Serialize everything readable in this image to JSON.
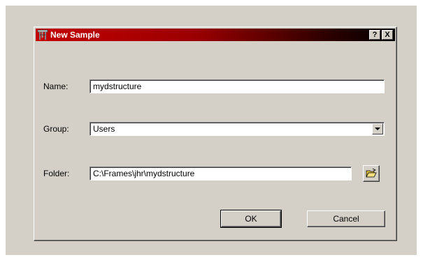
{
  "dialog": {
    "title": "New Sample",
    "help_label": "?",
    "close_label": "X"
  },
  "form": {
    "name_label": "Name:",
    "name_value": "mydstructure",
    "group_label": "Group:",
    "group_value": "Users",
    "folder_label": "Folder:",
    "folder_value": "C:\\Frames\\jhr\\mydstructure"
  },
  "buttons": {
    "ok_label": "OK",
    "cancel_label": "Cancel"
  },
  "colors": {
    "title_gradient_start": "#c40000",
    "title_gradient_end": "#000000",
    "face": "#d4d0c8"
  },
  "icons": {
    "app": "structure-icon",
    "dropdown": "chevron-down-icon",
    "browse": "folder-open-icon"
  }
}
